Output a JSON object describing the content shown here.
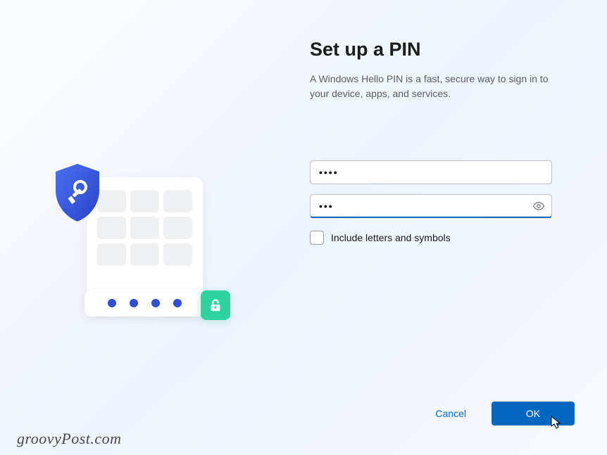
{
  "header": {
    "title": "Set up a PIN",
    "subtitle": "A Windows Hello PIN is a fast, secure way to sign in to your device, apps, and services."
  },
  "form": {
    "pin_value": "••••",
    "confirm_pin_value": "•••",
    "checkbox_label": "Include letters and symbols",
    "checkbox_checked": false
  },
  "buttons": {
    "cancel": "Cancel",
    "ok": "OK"
  },
  "icons": {
    "shield": "shield-key-icon",
    "lock": "unlock-icon",
    "reveal": "eye-icon"
  },
  "watermark": "groovyPost.com",
  "colors": {
    "primary": "#0067c0",
    "accent_green": "#2dd4a0",
    "shield_blue": "#3c5fdd"
  }
}
